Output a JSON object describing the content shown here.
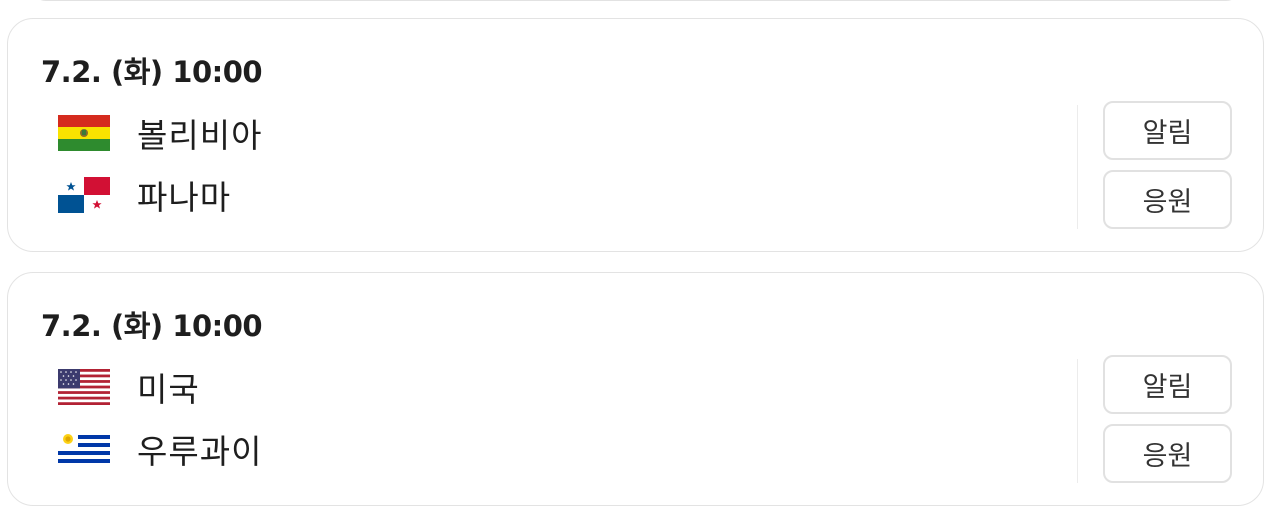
{
  "matches": [
    {
      "datetime": "7.2. (화) 10:00",
      "home": {
        "name": "볼리비아",
        "flag": "bolivia-flag"
      },
      "away": {
        "name": "파나마",
        "flag": "panama-flag"
      },
      "alert_label": "알림",
      "cheer_label": "응원"
    },
    {
      "datetime": "7.2. (화) 10:00",
      "home": {
        "name": "미국",
        "flag": "usa-flag"
      },
      "away": {
        "name": "우루과이",
        "flag": "uruguay-flag"
      },
      "alert_label": "알림",
      "cheer_label": "응원"
    }
  ],
  "colors": {
    "border": "#e3e3e3",
    "text": "#1e1e1e",
    "button_border": "#e1e1e1"
  }
}
